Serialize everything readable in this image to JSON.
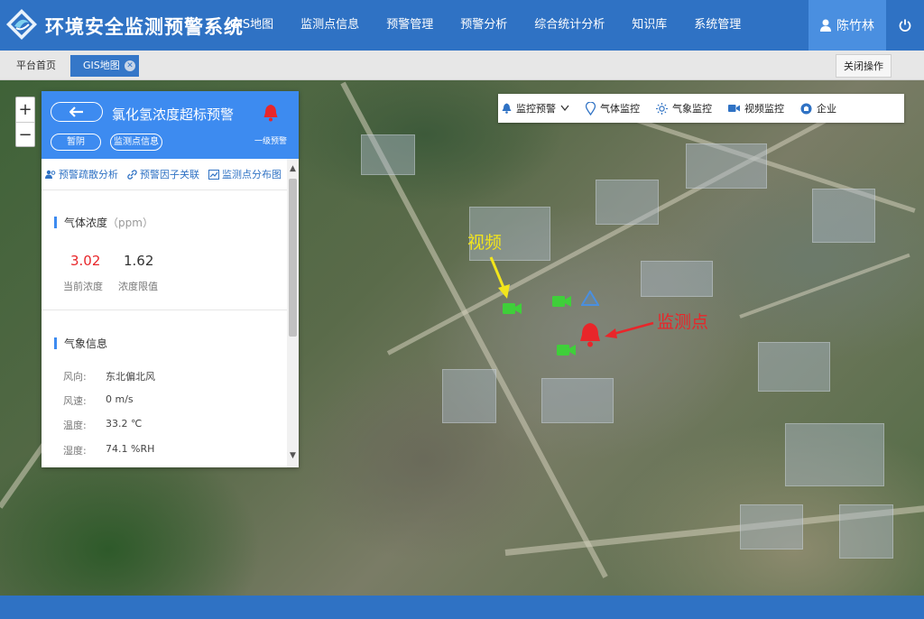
{
  "header": {
    "app_title": "环境安全监测预警系统",
    "nav": [
      "GIS地图",
      "监测点信息",
      "预警管理",
      "预警分析",
      "综合统计分析",
      "知识库",
      "系统管理"
    ],
    "user_name": "陈竹林"
  },
  "tabs": {
    "home": "平台首页",
    "gis": "GIS地图",
    "close_ops": "关闭操作"
  },
  "map": {
    "zoom_in": "+",
    "zoom_out": "−",
    "layers": [
      "监控预警",
      "气体监控",
      "气象监控",
      "视频监控",
      "企业"
    ],
    "annotation_video": "视频",
    "annotation_monitor": "监测点"
  },
  "panel": {
    "title": "氯化氢浓度超标预警",
    "snooze": "暂阴",
    "site_info": "监测点信息",
    "level": "一级预警",
    "actions": [
      "预警疏散分析",
      "预警因子关联",
      "监测点分布图"
    ],
    "gas": {
      "title": "气体浓度",
      "unit": "（ppm）",
      "current_value": "3.02",
      "current_label": "当前浓度",
      "limit_value": "1.62",
      "limit_label": "浓度限值"
    },
    "weather": {
      "title": "气象信息",
      "rows": [
        {
          "k": "风向:",
          "v": "东北偏北风"
        },
        {
          "k": "风速:",
          "v": "0 m/s"
        },
        {
          "k": "温度:",
          "v": "33.2 ℃"
        },
        {
          "k": "湿度:",
          "v": "74.1 %RH"
        }
      ]
    }
  },
  "colors": {
    "primary": "#2f72c4",
    "panel_header": "#3d8bf0",
    "alarm_red": "#e8262a",
    "video_green": "#3fcf3a",
    "annotation_yellow": "#f2e51c"
  }
}
